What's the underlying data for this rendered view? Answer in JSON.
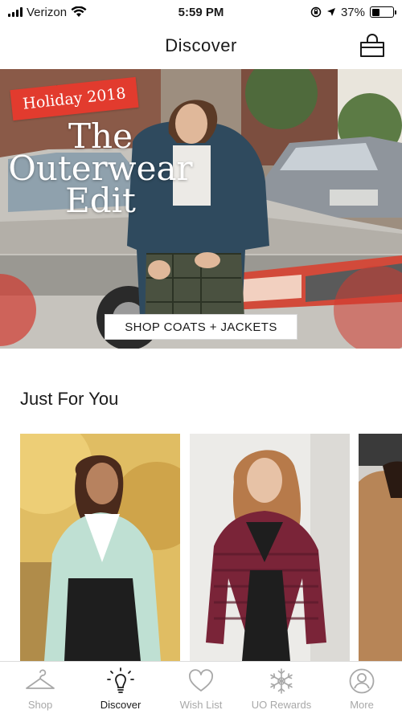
{
  "status_bar": {
    "carrier": "Verizon",
    "time": "5:59 PM",
    "battery": "37%",
    "battery_level": 0.37
  },
  "header": {
    "title": "Discover",
    "bag_icon": "shopping-bag-icon"
  },
  "hero": {
    "tag": "Holiday 2018",
    "headline": "The Outerwear Edit",
    "cta": "SHOP COATS + JACKETS",
    "tag_color": "#e23b2e"
  },
  "just_for_you": {
    "title": "Just For You",
    "products": [
      {
        "image": "product-photo-mint-cardigan"
      },
      {
        "image": "product-photo-burgundy-striped-cardigan"
      },
      {
        "image": "product-photo-tan-sweater"
      }
    ]
  },
  "tab_bar": {
    "tabs": [
      {
        "label": "Shop",
        "icon": "hanger-icon",
        "active": false
      },
      {
        "label": "Discover",
        "icon": "lightbulb-icon",
        "active": true
      },
      {
        "label": "Wish List",
        "icon": "heart-icon",
        "active": false
      },
      {
        "label": "UO Rewards",
        "icon": "snowflake-icon",
        "active": false
      },
      {
        "label": "More",
        "icon": "user-circle-icon",
        "active": false
      }
    ]
  }
}
